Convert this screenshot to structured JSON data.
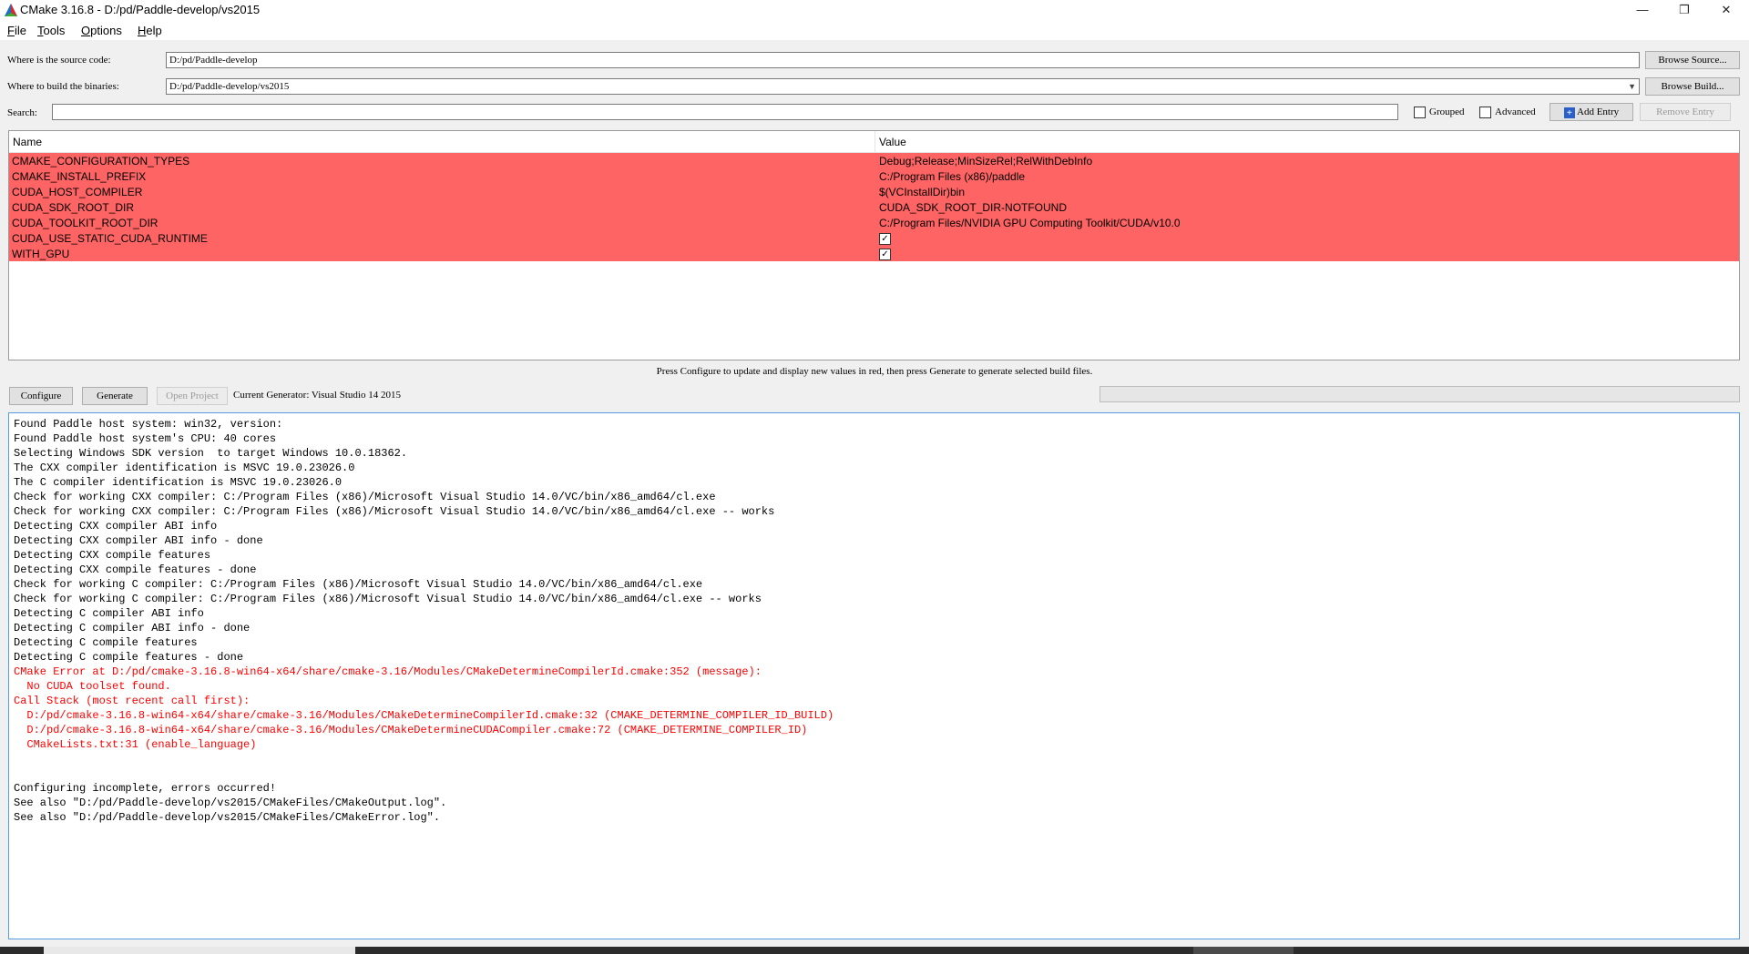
{
  "window": {
    "title": "CMake 3.16.8 - D:/pd/Paddle-develop/vs2015",
    "minimize_icon": "minimize-icon",
    "maximize_icon": "restore-icon",
    "close_icon": "close-icon",
    "minimize_glyph": "—",
    "maximize_glyph": "❐",
    "close_glyph": "✕"
  },
  "menu": [
    "File",
    "Tools",
    "Options",
    "Help"
  ],
  "source": {
    "label": "Where is the source code:",
    "value": "D:/pd/Paddle-develop",
    "browse_label": "Browse Source..."
  },
  "build": {
    "label": "Where to build the binaries:",
    "value": "D:/pd/Paddle-develop/vs2015",
    "browse_label": "Browse Build..."
  },
  "search": {
    "label": "Search:",
    "value": "",
    "grouped_label": "Grouped",
    "grouped_checked": false,
    "advanced_label": "Advanced",
    "advanced_checked": false,
    "add_entry_label": "Add Entry",
    "remove_entry_label": "Remove Entry"
  },
  "table": {
    "headers": [
      "Name",
      "Value"
    ],
    "highlight_color": "#ff6464",
    "rows": [
      {
        "name": "CMAKE_CONFIGURATION_TYPES",
        "value": "Debug;Release;MinSizeRel;RelWithDebInfo",
        "type": "text"
      },
      {
        "name": "CMAKE_INSTALL_PREFIX",
        "value": "C:/Program Files (x86)/paddle",
        "type": "text"
      },
      {
        "name": "CUDA_HOST_COMPILER",
        "value": "$(VCInstallDir)bin",
        "type": "text"
      },
      {
        "name": "CUDA_SDK_ROOT_DIR",
        "value": "CUDA_SDK_ROOT_DIR-NOTFOUND",
        "type": "text"
      },
      {
        "name": "CUDA_TOOLKIT_ROOT_DIR",
        "value": "C:/Program Files/NVIDIA GPU Computing Toolkit/CUDA/v10.0",
        "type": "text"
      },
      {
        "name": "CUDA_USE_STATIC_CUDA_RUNTIME",
        "value": "✓",
        "type": "checkbox",
        "checked": true
      },
      {
        "name": "WITH_GPU",
        "value": "✓",
        "type": "checkbox",
        "checked": true
      }
    ]
  },
  "info_text": "Press Configure to update and display new values in red, then press Generate to generate selected build files.",
  "actions": {
    "configure_label": "Configure",
    "generate_label": "Generate",
    "open_project_label": "Open Project",
    "current_generator": "Current Generator: Visual Studio 14 2015"
  },
  "output": {
    "error_color": "#ff0000",
    "lines": [
      {
        "text": "Found Paddle host system: win32, version:",
        "error": false
      },
      {
        "text": "Found Paddle host system's CPU: 40 cores",
        "error": false
      },
      {
        "text": "Selecting Windows SDK version  to target Windows 10.0.18362.",
        "error": false
      },
      {
        "text": "The CXX compiler identification is MSVC 19.0.23026.0",
        "error": false
      },
      {
        "text": "The C compiler identification is MSVC 19.0.23026.0",
        "error": false
      },
      {
        "text": "Check for working CXX compiler: C:/Program Files (x86)/Microsoft Visual Studio 14.0/VC/bin/x86_amd64/cl.exe",
        "error": false
      },
      {
        "text": "Check for working CXX compiler: C:/Program Files (x86)/Microsoft Visual Studio 14.0/VC/bin/x86_amd64/cl.exe -- works",
        "error": false
      },
      {
        "text": "Detecting CXX compiler ABI info",
        "error": false
      },
      {
        "text": "Detecting CXX compiler ABI info - done",
        "error": false
      },
      {
        "text": "Detecting CXX compile features",
        "error": false
      },
      {
        "text": "Detecting CXX compile features - done",
        "error": false
      },
      {
        "text": "Check for working C compiler: C:/Program Files (x86)/Microsoft Visual Studio 14.0/VC/bin/x86_amd64/cl.exe",
        "error": false
      },
      {
        "text": "Check for working C compiler: C:/Program Files (x86)/Microsoft Visual Studio 14.0/VC/bin/x86_amd64/cl.exe -- works",
        "error": false
      },
      {
        "text": "Detecting C compiler ABI info",
        "error": false
      },
      {
        "text": "Detecting C compiler ABI info - done",
        "error": false
      },
      {
        "text": "Detecting C compile features",
        "error": false
      },
      {
        "text": "Detecting C compile features - done",
        "error": false
      },
      {
        "text": "CMake Error at D:/pd/cmake-3.16.8-win64-x64/share/cmake-3.16/Modules/CMakeDetermineCompilerId.cmake:352 (message):",
        "error": true
      },
      {
        "text": "  No CUDA toolset found.",
        "error": true
      },
      {
        "text": "Call Stack (most recent call first):",
        "error": true
      },
      {
        "text": "  D:/pd/cmake-3.16.8-win64-x64/share/cmake-3.16/Modules/CMakeDetermineCompilerId.cmake:32 (CMAKE_DETERMINE_COMPILER_ID_BUILD)",
        "error": true
      },
      {
        "text": "  D:/pd/cmake-3.16.8-win64-x64/share/cmake-3.16/Modules/CMakeDetermineCUDACompiler.cmake:72 (CMAKE_DETERMINE_COMPILER_ID)",
        "error": true
      },
      {
        "text": "  CMakeLists.txt:31 (enable_language)",
        "error": true
      },
      {
        "text": "",
        "error": false
      },
      {
        "text": "",
        "error": false
      },
      {
        "text": "Configuring incomplete, errors occurred!",
        "error": false
      },
      {
        "text": "See also \"D:/pd/Paddle-develop/vs2015/CMakeFiles/CMakeOutput.log\".",
        "error": false
      },
      {
        "text": "See also \"D:/pd/Paddle-develop/vs2015/CMakeFiles/CMakeError.log\".",
        "error": false
      }
    ]
  }
}
